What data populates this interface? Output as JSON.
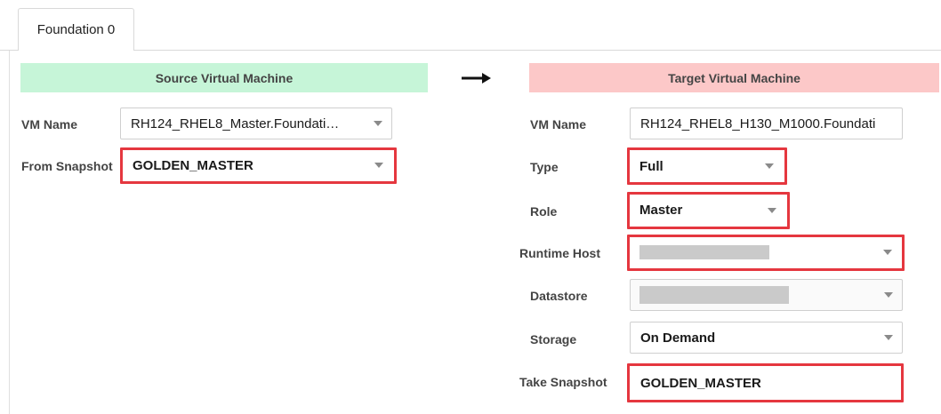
{
  "tab": {
    "label": "Foundation 0"
  },
  "source": {
    "header": "Source Virtual Machine",
    "vm_name": {
      "label": "VM Name",
      "value": "RH124_RHEL8_Master.Foundati…"
    },
    "from_snapshot": {
      "label": "From Snapshot",
      "value": "GOLDEN_MASTER"
    }
  },
  "arrow_icon": "right-arrow-icon",
  "target": {
    "header": "Target Virtual Machine",
    "vm_name": {
      "label": "VM Name",
      "value": "RH124_RHEL8_H130_M1000.Foundati"
    },
    "type": {
      "label": "Type",
      "value": "Full"
    },
    "role": {
      "label": "Role",
      "value": "Master"
    },
    "runtime_host": {
      "label": "Runtime Host",
      "value": ""
    },
    "datastore": {
      "label": "Datastore",
      "value": ""
    },
    "storage": {
      "label": "Storage",
      "value": "On Demand"
    },
    "take_snapshot": {
      "label": "Take Snapshot",
      "value": "GOLDEN_MASTER"
    }
  },
  "colors": {
    "source_header_bg": "#c6f5d8",
    "target_header_bg": "#fcc8c8",
    "highlight": "#e5373f"
  }
}
